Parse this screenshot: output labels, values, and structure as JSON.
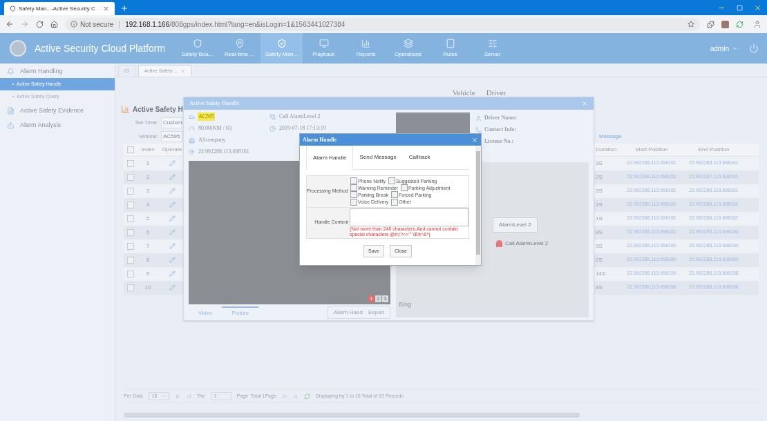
{
  "browser": {
    "tab_title": "Safety Man...-Active Security C",
    "security": "Not secure",
    "url_host": "192.168.1.166",
    "url_path": "/808gps/index.html?lang=en&isLogin=1&1563441027384"
  },
  "header": {
    "title": "Active Security Cloud Platform",
    "user": "admin",
    "nav": [
      {
        "label": "Safety Boa...",
        "selected": false
      },
      {
        "label": "Real-time ...",
        "selected": false
      },
      {
        "label": "Safety Man...",
        "selected": true
      },
      {
        "label": "Playback",
        "selected": false
      },
      {
        "label": "Reports",
        "selected": false
      },
      {
        "label": "Operations",
        "selected": false
      },
      {
        "label": "Rules",
        "selected": false
      },
      {
        "label": "Server",
        "selected": false
      }
    ]
  },
  "sidebar": {
    "items": [
      {
        "label": "Alarm Handling",
        "kind": "group"
      },
      {
        "label": "Active Safety Handle",
        "kind": "sub",
        "selected": true
      },
      {
        "label": "Active Safety Query",
        "kind": "sub",
        "selected": false
      },
      {
        "label": "Active Safety Evidence",
        "kind": "group"
      },
      {
        "label": "Alarm Analysis",
        "kind": "group"
      }
    ]
  },
  "page_tabs": [
    {
      "label": "Cl",
      "selected": false
    },
    {
      "label": "Active Safety ...",
      "selected": true
    }
  ],
  "view_switch": [
    "Vehicle",
    "Driver"
  ],
  "page": {
    "title": "Active Safety H",
    "filters": [
      {
        "label": "Sel Time:",
        "value": "Custom"
      },
      {
        "label": "Vehicle:",
        "value": "AC595"
      }
    ],
    "message_link": "Message"
  },
  "table": {
    "all_checked": false,
    "columns": [
      "Index",
      "Operate",
      "Duration",
      "Start Position",
      "End Position"
    ],
    "rows": [
      {
        "index": "1",
        "duration": "3S",
        "start": "22.992288,113.698161",
        "end": "22.992288,113.698161",
        "checked": false
      },
      {
        "index": "2",
        "duration": "2S",
        "start": "22.992288,113.698161",
        "end": "22.992287,113.698161",
        "checked": false
      },
      {
        "index": "3",
        "duration": "3S",
        "start": "22.992288,113.698161",
        "end": "22.992288,113.698161",
        "checked": false
      },
      {
        "index": "4",
        "duration": "3S",
        "start": "22.992288,113.698161",
        "end": "22.992288,113.698161",
        "checked": false
      },
      {
        "index": "5",
        "duration": "1S",
        "start": "22.992288,113.698161",
        "end": "22.992288,113.698161",
        "checked": false
      },
      {
        "index": "6",
        "duration": "8S",
        "start": "22.992285,113.698161",
        "end": "22.992295,113.698160",
        "checked": false
      },
      {
        "index": "7",
        "duration": "3S",
        "start": "22.992288,113.698160",
        "end": "22.992288,113.698160",
        "checked": false
      },
      {
        "index": "8",
        "duration": "2S",
        "start": "22.992288,113.698160",
        "end": "22.992288,113.698160",
        "checked": false
      },
      {
        "index": "9",
        "duration": "14S",
        "start": "22.992288,113.698159",
        "end": "22.992288,113.698158",
        "checked": false
      },
      {
        "index": "10",
        "duration": "8S",
        "start": "22.992288,113.698158",
        "end": "22.992288,113.698158",
        "checked": false
      }
    ]
  },
  "pagination": {
    "per_data_label": "Per Data",
    "per_data": "15",
    "the_label": "The",
    "page": "1",
    "page_total": "Page  Total 1Page",
    "status": "Displaying by 1 to 10 Total of 10 Records"
  },
  "detail_dialog": {
    "title": "Active Safety Handle",
    "info_columns": [
      [
        {
          "kind": "plate",
          "text": "AC595",
          "highlighted": true
        },
        {
          "kind": "speed",
          "text": "80.00(KM / H)",
          "highlighted": false
        },
        {
          "kind": "company",
          "text": "AScompany",
          "highlighted": false
        },
        {
          "kind": "location",
          "text": "22.992288,113.698161",
          "highlighted": false
        }
      ],
      [
        {
          "kind": "alarm",
          "text": "Call AlarmLevel 2",
          "highlighted": false
        },
        {
          "kind": "time",
          "text": "2019-07-18 17:13:19",
          "highlighted": false
        }
      ]
    ],
    "driver": [
      {
        "kind": "person",
        "text": "Driver Name:"
      },
      {
        "kind": "phone",
        "text": "Contact Info:"
      },
      {
        "kind": "card",
        "text": "License No.:"
      }
    ],
    "pages": [
      {
        "label": "1",
        "selected": true
      },
      {
        "label": "2",
        "selected": false
      },
      {
        "label": "3",
        "selected": false
      }
    ],
    "media_tabs": [
      {
        "label": "Video",
        "selected": false
      },
      {
        "label": "Picture",
        "selected": true
      }
    ],
    "buttons": [
      "Alarm Hand",
      "Export"
    ],
    "map": {
      "marker_label": "Call AlarmLevel 2",
      "popup_label": "AlarmLevel 2",
      "brand": "Bing"
    }
  },
  "alarm_dialog": {
    "title": "Alarm Handle",
    "tabs": [
      {
        "label": "Alarm Handle",
        "selected": true
      },
      {
        "label": "Send Message",
        "selected": false
      },
      {
        "label": "Callback",
        "selected": false
      }
    ],
    "method_label": "Processing Method",
    "options": [
      {
        "label": "Phone Notify",
        "checked": false
      },
      {
        "label": "Suggested Parking",
        "checked": false
      },
      {
        "label": "Warning Reminder",
        "checked": false
      },
      {
        "label": "Parking Adjustment",
        "checked": false
      },
      {
        "label": "Parking Break",
        "checked": false
      },
      {
        "label": "Forced Parking",
        "checked": false
      },
      {
        "label": "Voice Delivery",
        "checked": false
      },
      {
        "label": "Other",
        "checked": false
      }
    ],
    "content_label": "Handle Content",
    "note": "(Not more than 240 characters,And cannot contain special characters @#;/?<>'\"`\\$%^&*)",
    "buttons": [
      "Save",
      "Close"
    ]
  }
}
